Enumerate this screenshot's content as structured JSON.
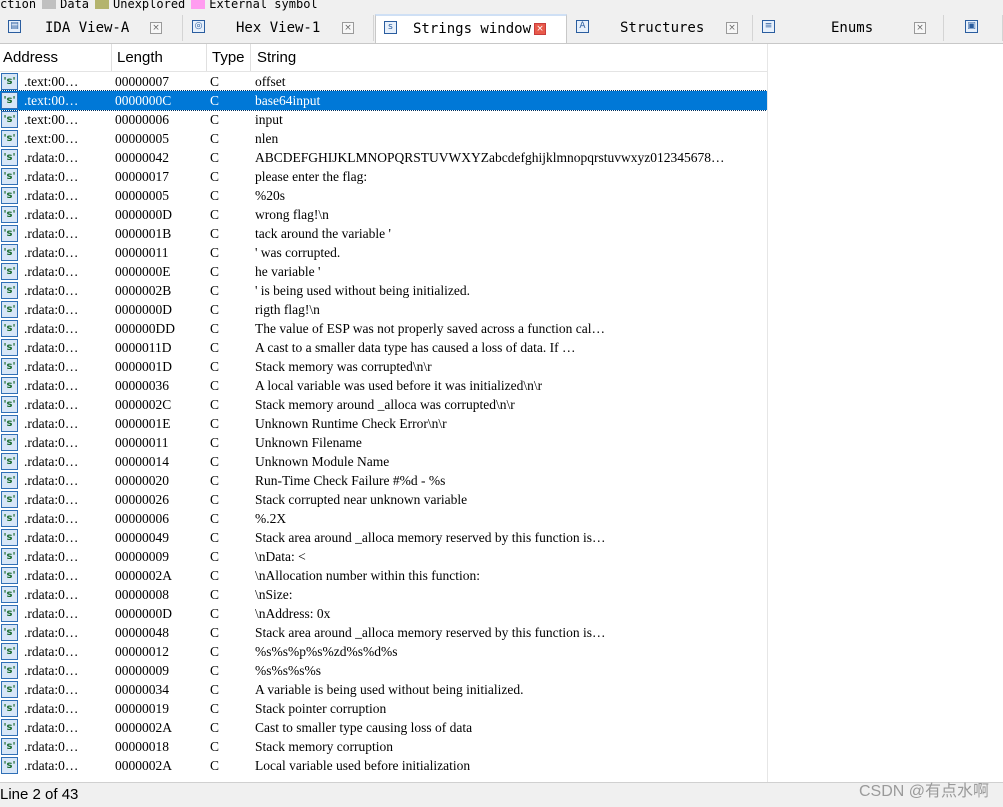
{
  "legend": [
    {
      "label": "ction",
      "color": ""
    },
    {
      "label": "Data",
      "color": "#c0c0c0"
    },
    {
      "label": "Unexplored",
      "color": "#b4b46e"
    },
    {
      "label": "External symbol",
      "color": "#ff9cf0"
    }
  ],
  "tabs": [
    {
      "label": "IDA View-A",
      "icon": "ida-view-icon",
      "close": "×",
      "active": false
    },
    {
      "label": "Hex View-1",
      "icon": "hex-view-icon",
      "close": "×",
      "active": false
    },
    {
      "label": "Strings window",
      "icon": "strings-icon",
      "close": "×",
      "active": true
    },
    {
      "label": "Structures",
      "icon": "structures-icon",
      "close": "×",
      "active": false
    },
    {
      "label": "Enums",
      "icon": "enums-icon",
      "close": "×",
      "active": false
    },
    {
      "label": "",
      "icon": "imports-icon",
      "close": "",
      "active": false
    }
  ],
  "columns": {
    "address": "Address",
    "length": "Length",
    "type": "Type",
    "string": "String"
  },
  "row_icon_glyph": "'s'",
  "rows": [
    {
      "address": ".text:00…",
      "length": "00000007",
      "type": "C",
      "string": "offset"
    },
    {
      "address": ".text:00…",
      "length": "0000000C",
      "type": "C",
      "string": "base64input",
      "selected": true
    },
    {
      "address": ".text:00…",
      "length": "00000006",
      "type": "C",
      "string": "input"
    },
    {
      "address": ".text:00…",
      "length": "00000005",
      "type": "C",
      "string": "nlen"
    },
    {
      "address": ".rdata:0…",
      "length": "00000042",
      "type": "C",
      "string": "ABCDEFGHIJKLMNOPQRSTUVWXYZabcdefghijklmnopqrstuvwxyz012345678…"
    },
    {
      "address": ".rdata:0…",
      "length": "00000017",
      "type": "C",
      "string": "please enter the flag:"
    },
    {
      "address": ".rdata:0…",
      "length": "00000005",
      "type": "C",
      "string": "%20s"
    },
    {
      "address": ".rdata:0…",
      "length": "0000000D",
      "type": "C",
      "string": "wrong flag!\\n"
    },
    {
      "address": ".rdata:0…",
      "length": "0000001B",
      "type": "C",
      "string": "tack around the variable '"
    },
    {
      "address": ".rdata:0…",
      "length": "00000011",
      "type": "C",
      "string": "' was corrupted."
    },
    {
      "address": ".rdata:0…",
      "length": "0000000E",
      "type": "C",
      "string": "he variable '"
    },
    {
      "address": ".rdata:0…",
      "length": "0000002B",
      "type": "C",
      "string": "' is being used without being initialized."
    },
    {
      "address": ".rdata:0…",
      "length": "0000000D",
      "type": "C",
      "string": "rigth flag!\\n"
    },
    {
      "address": ".rdata:0…",
      "length": "000000DD",
      "type": "C",
      "string": "The value of ESP was not properly saved across a function cal…"
    },
    {
      "address": ".rdata:0…",
      "length": "0000011D",
      "type": "C",
      "string": "A cast to a smaller data type has caused a loss of data.  If …"
    },
    {
      "address": ".rdata:0…",
      "length": "0000001D",
      "type": "C",
      "string": "Stack memory was corrupted\\n\\r"
    },
    {
      "address": ".rdata:0…",
      "length": "00000036",
      "type": "C",
      "string": "A local variable was used before it was initialized\\n\\r"
    },
    {
      "address": ".rdata:0…",
      "length": "0000002C",
      "type": "C",
      "string": "Stack memory around _alloca was corrupted\\n\\r"
    },
    {
      "address": ".rdata:0…",
      "length": "0000001E",
      "type": "C",
      "string": "Unknown Runtime Check Error\\n\\r"
    },
    {
      "address": ".rdata:0…",
      "length": "00000011",
      "type": "C",
      "string": "Unknown Filename"
    },
    {
      "address": ".rdata:0…",
      "length": "00000014",
      "type": "C",
      "string": "Unknown Module Name"
    },
    {
      "address": ".rdata:0…",
      "length": "00000020",
      "type": "C",
      "string": "Run-Time Check Failure #%d - %s"
    },
    {
      "address": ".rdata:0…",
      "length": "00000026",
      "type": "C",
      "string": "Stack corrupted near unknown variable"
    },
    {
      "address": ".rdata:0…",
      "length": "00000006",
      "type": "C",
      "string": "%.2X"
    },
    {
      "address": ".rdata:0…",
      "length": "00000049",
      "type": "C",
      "string": "Stack area around _alloca memory reserved by this function is…"
    },
    {
      "address": ".rdata:0…",
      "length": "00000009",
      "type": "C",
      "string": "\\nData: <"
    },
    {
      "address": ".rdata:0…",
      "length": "0000002A",
      "type": "C",
      "string": "\\nAllocation number within this function:"
    },
    {
      "address": ".rdata:0…",
      "length": "00000008",
      "type": "C",
      "string": "\\nSize:"
    },
    {
      "address": ".rdata:0…",
      "length": "0000000D",
      "type": "C",
      "string": "\\nAddress: 0x"
    },
    {
      "address": ".rdata:0…",
      "length": "00000048",
      "type": "C",
      "string": "Stack area around _alloca memory reserved by this function is…"
    },
    {
      "address": ".rdata:0…",
      "length": "00000012",
      "type": "C",
      "string": "%s%s%p%s%zd%s%d%s"
    },
    {
      "address": ".rdata:0…",
      "length": "00000009",
      "type": "C",
      "string": "%s%s%s%s"
    },
    {
      "address": ".rdata:0…",
      "length": "00000034",
      "type": "C",
      "string": "A variable is being used without being initialized."
    },
    {
      "address": ".rdata:0…",
      "length": "00000019",
      "type": "C",
      "string": "Stack pointer corruption"
    },
    {
      "address": ".rdata:0…",
      "length": "0000002A",
      "type": "C",
      "string": "Cast to smaller type causing loss of data"
    },
    {
      "address": ".rdata:0…",
      "length": "00000018",
      "type": "C",
      "string": "Stack memory corruption"
    },
    {
      "address": ".rdata:0…",
      "length": "0000002A",
      "type": "C",
      "string": "Local variable used before initialization"
    }
  ],
  "status": "Line 2 of 43",
  "watermark": "CSDN @有点水啊",
  "colors": {
    "selection": "#0078d7",
    "active_close": "#e85a4a"
  }
}
